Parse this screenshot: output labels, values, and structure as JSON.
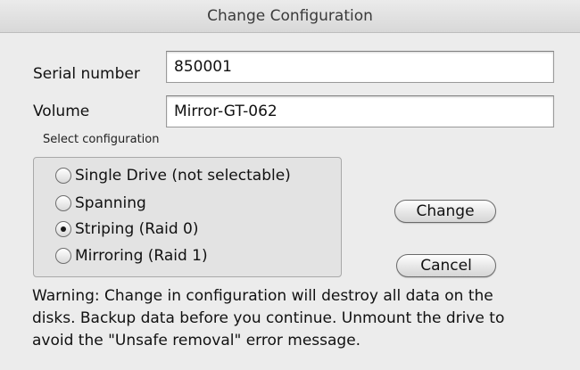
{
  "window": {
    "title": "Change Configuration"
  },
  "fields": {
    "serial_label": "Serial number",
    "serial_value": "850001",
    "volume_label": "Volume",
    "volume_value": "Mirror-GT-062"
  },
  "configuration": {
    "caption": "Select configuration",
    "options": [
      {
        "label": "Single Drive (not selectable)",
        "selected": false
      },
      {
        "label": "Spanning",
        "selected": false
      },
      {
        "label": "Striping (Raid 0)",
        "selected": true
      },
      {
        "label": "Mirroring (Raid 1)",
        "selected": false
      }
    ]
  },
  "buttons": {
    "change_label": "Change",
    "cancel_label": "Cancel"
  },
  "warning": {
    "line1": "Warning: Change in configuration will destroy all data on the",
    "line2": "disks. Backup data before you continue. Unmount the drive to",
    "line3": "avoid the \"Unsafe removal\" error message."
  },
  "colors": {
    "window_background": "#ececec",
    "group_background": "#e3e3e3"
  }
}
